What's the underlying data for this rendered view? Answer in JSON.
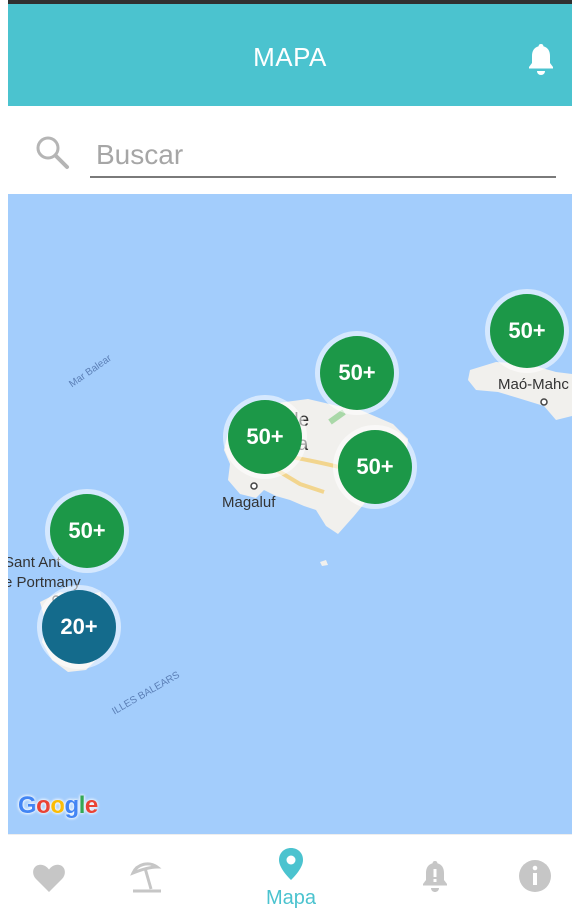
{
  "header": {
    "title": "MAPA"
  },
  "search": {
    "placeholder": "Buscar",
    "value": ""
  },
  "map": {
    "places": [
      "Palma de Mallorca",
      "Magaluf",
      "Maó-Mahón",
      "Sant Antoni de Portmany"
    ],
    "place_fragments": {
      "palma_1": "de",
      "palma_2": "ca",
      "sant_1": "Sant Ant",
      "sant_2": "e Portmany",
      "mao": "Maó-Mahc"
    },
    "water_labels": {
      "mar_balear": "Mar Balear",
      "illes_balears": "ILLES BALEARS"
    },
    "clusters": [
      {
        "label": "50+",
        "color": "#1c9848"
      },
      {
        "label": "50+",
        "color": "#1c9848"
      },
      {
        "label": "50+",
        "color": "#1c9848"
      },
      {
        "label": "50+",
        "color": "#1c9848"
      },
      {
        "label": "50+",
        "color": "#1c9848"
      },
      {
        "label": "20+",
        "color": "#146b8c"
      }
    ],
    "attribution": "Google"
  },
  "nav": {
    "items": [
      {
        "icon": "heart-icon",
        "label": ""
      },
      {
        "icon": "beach-umbrella-icon",
        "label": ""
      },
      {
        "icon": "map-pin-icon",
        "label": "Mapa"
      },
      {
        "icon": "bell-alert-icon",
        "label": ""
      },
      {
        "icon": "info-icon",
        "label": ""
      }
    ],
    "active": "Mapa"
  },
  "colors": {
    "accent": "#4bc3cf",
    "water": "#a3cdfc",
    "cluster_green": "#1c9848",
    "cluster_blue": "#146b8c",
    "inactive_icon": "#c6c6c6"
  }
}
